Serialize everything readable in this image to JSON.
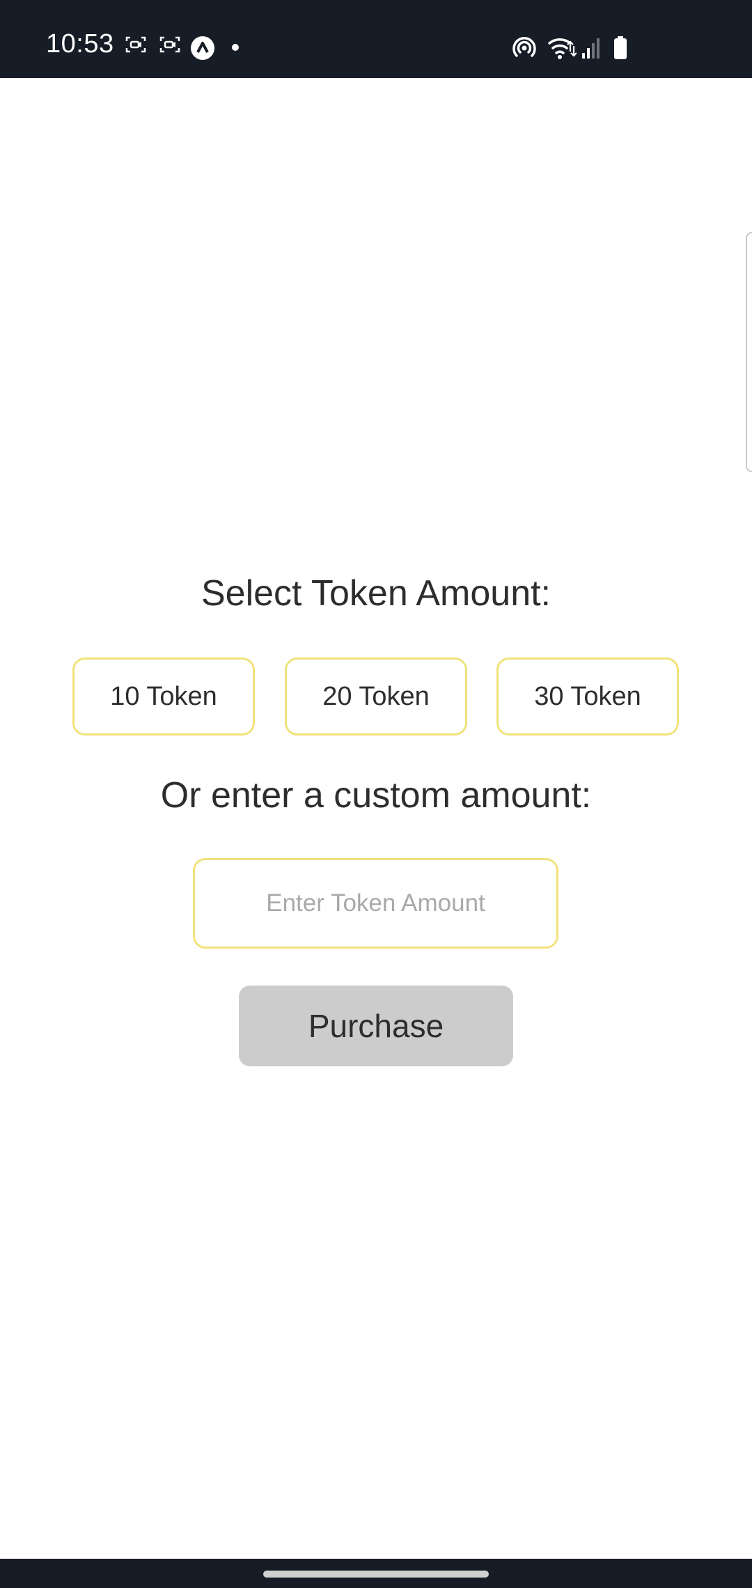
{
  "status_bar": {
    "time": "10:53",
    "icons_left": [
      "screen-record-icon",
      "screen-record-icon",
      "app-notification-icon",
      "notification-dot"
    ],
    "icons_right": [
      "hotspot-icon",
      "wifi-icon",
      "signal-icon",
      "battery-icon"
    ]
  },
  "token_selection": {
    "title": "Select Token Amount:",
    "options": [
      {
        "label": "10 Token"
      },
      {
        "label": "20 Token"
      },
      {
        "label": "30 Token"
      }
    ]
  },
  "custom_amount": {
    "label": "Or enter a custom amount:",
    "input_placeholder": "Enter Token Amount",
    "input_value": ""
  },
  "purchase": {
    "label": "Purchase"
  },
  "colors": {
    "status_bar_bg": "#161d26",
    "accent_border": "#f1e27a",
    "button_disabled_bg": "#cccccc",
    "text": "#2d2d2d"
  }
}
